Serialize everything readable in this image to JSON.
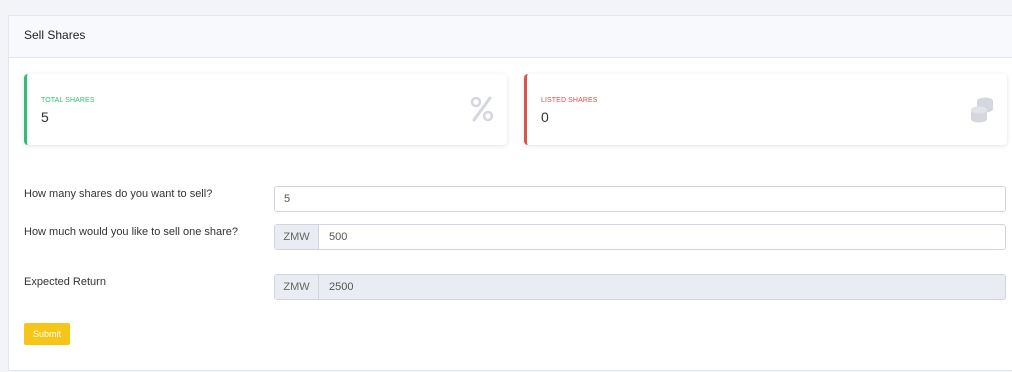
{
  "header": {
    "title": "Sell Shares"
  },
  "stats": {
    "total": {
      "label": "TOTAL SHARES",
      "value": "5",
      "icon": "percent-icon",
      "accent": "#2fbf71"
    },
    "listed": {
      "label": "LISTED SHARES",
      "value": "0",
      "icon": "coins-icon",
      "accent": "#d9534f"
    }
  },
  "form": {
    "quantity": {
      "label": "How many shares do you want to sell?",
      "value": "5"
    },
    "price": {
      "label": "How much would you like to sell one share?",
      "currency": "ZMW",
      "value": "500"
    },
    "expected": {
      "label": "Expected Return",
      "currency": "ZMW",
      "value": "2500"
    },
    "submit_label": "Submit",
    "submit_color": "#f5c518"
  }
}
